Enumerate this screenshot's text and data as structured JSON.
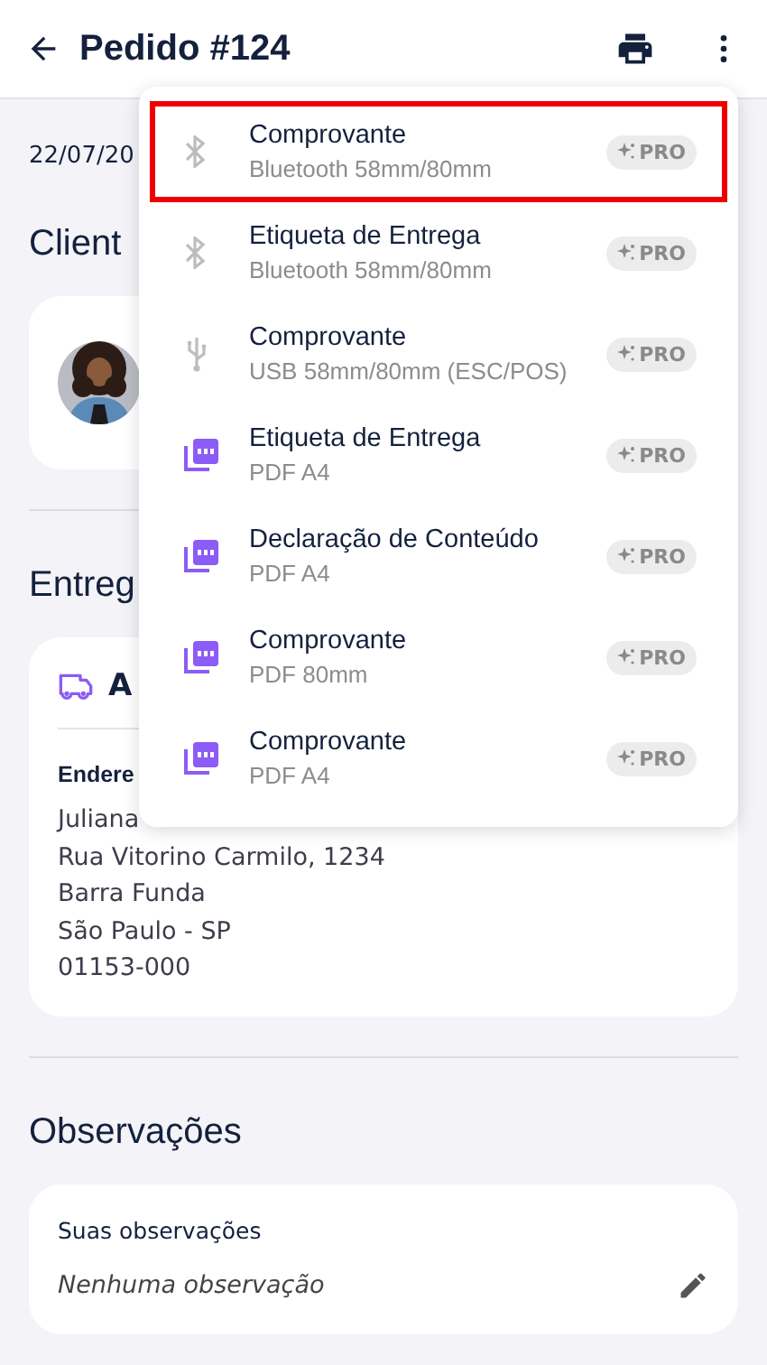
{
  "header": {
    "title": "Pedido #124"
  },
  "date": "22/07/20",
  "customer": {
    "heading": "Client"
  },
  "delivery": {
    "heading": "Entreg",
    "status": "A",
    "address_label": "Endere",
    "address_lines": [
      "Juliana",
      "Rua Vitorino Carmilo, 1234",
      "Barra Funda",
      "São Paulo - SP",
      "01153-000"
    ]
  },
  "notes": {
    "heading": "Observações",
    "label": "Suas observações",
    "value": "Nenhuma observação"
  },
  "print_menu": [
    {
      "kind": "bluetooth",
      "title": "Comprovante",
      "subtitle": "Bluetooth 58mm/80mm",
      "badge": "PRO",
      "selected": true
    },
    {
      "kind": "bluetooth",
      "title": "Etiqueta de Entrega",
      "subtitle": "Bluetooth 58mm/80mm",
      "badge": "PRO",
      "selected": false
    },
    {
      "kind": "usb",
      "title": "Comprovante",
      "subtitle": "USB 58mm/80mm (ESC/POS)",
      "badge": "PRO",
      "selected": false
    },
    {
      "kind": "pdf",
      "title": "Etiqueta de Entrega",
      "subtitle": "PDF A4",
      "badge": "PRO",
      "selected": false
    },
    {
      "kind": "pdf",
      "title": "Declaração de Conteúdo",
      "subtitle": "PDF A4",
      "badge": "PRO",
      "selected": false
    },
    {
      "kind": "pdf",
      "title": "Comprovante",
      "subtitle": "PDF 80mm",
      "badge": "PRO",
      "selected": false
    },
    {
      "kind": "pdf",
      "title": "Comprovante",
      "subtitle": "PDF A4",
      "badge": "PRO",
      "selected": false
    }
  ]
}
